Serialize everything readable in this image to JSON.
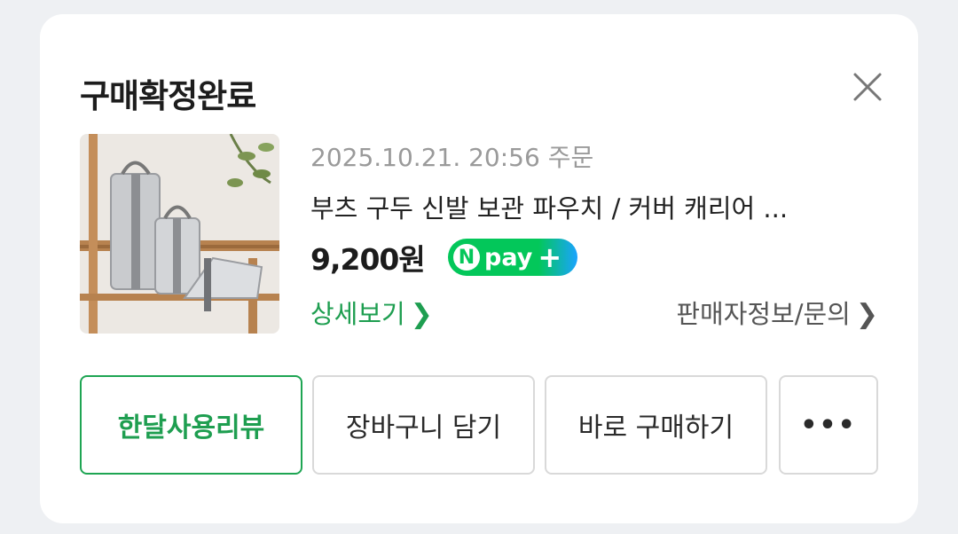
{
  "card": {
    "title": "구매확정완료",
    "close_icon": "close-icon"
  },
  "order": {
    "date": "2025.10.21. 20:56 주문",
    "product_name": "부츠 구두 신발 보관 파우치 / 커버 캐리어 ...",
    "price": "9,200원",
    "npay_logo_text": "pay",
    "npay_n": "N",
    "npay_plus": "+"
  },
  "links": {
    "detail": "상세보기",
    "seller": "판매자정보/문의"
  },
  "buttons": {
    "review": "한달사용리뷰",
    "cart": "장바구니 담기",
    "buy_now": "바로 구매하기",
    "more": "•••"
  },
  "colors": {
    "accent_green": "#1e9e50",
    "npay_green": "#03c75a",
    "npay_blue": "#1aa3ff"
  }
}
